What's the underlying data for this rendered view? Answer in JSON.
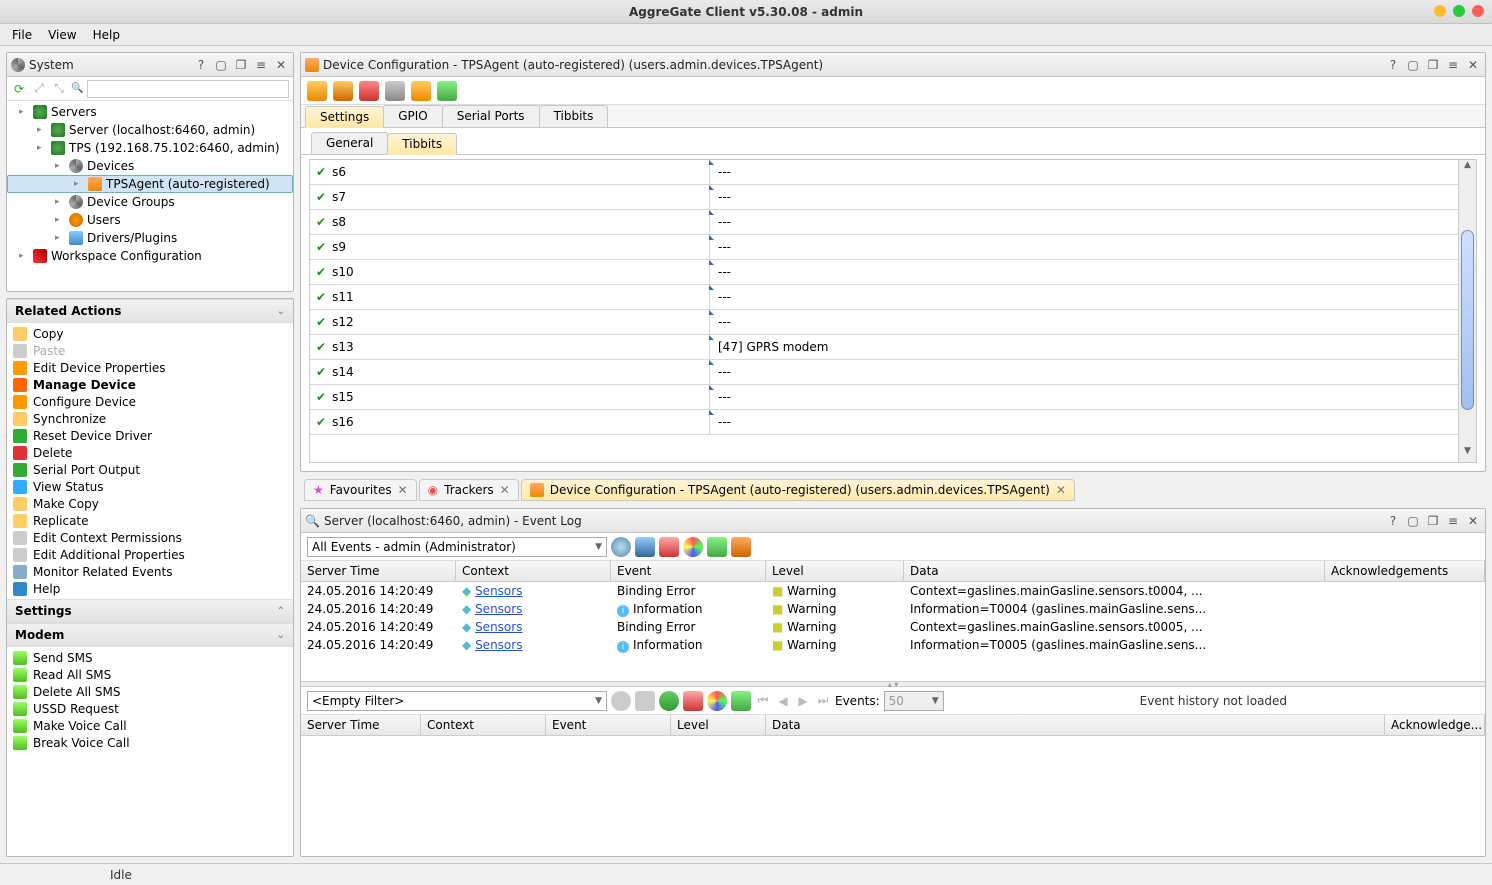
{
  "window": {
    "title": "AggreGate Client v5.30.08 - admin"
  },
  "menu": [
    "File",
    "View",
    "Help"
  ],
  "status": {
    "text": "Idle"
  },
  "system_panel": {
    "title": "System",
    "search_placeholder": "",
    "tree": [
      {
        "label": "Servers",
        "depth": 0
      },
      {
        "label": "Server (localhost:6460, admin)",
        "depth": 1
      },
      {
        "label": "TPS (192.168.75.102:6460, admin)",
        "depth": 1
      },
      {
        "label": "Devices",
        "depth": 2
      },
      {
        "label": "TPSAgent (auto-registered)",
        "depth": 3,
        "selected": true
      },
      {
        "label": "Device Groups",
        "depth": 2
      },
      {
        "label": "Users",
        "depth": 2
      },
      {
        "label": "Drivers/Plugins",
        "depth": 2
      },
      {
        "label": "Workspace Configuration",
        "depth": 0
      }
    ]
  },
  "related_actions": {
    "title": "Related Actions",
    "items": [
      "Copy",
      "Paste",
      "Edit Device Properties",
      "Manage Device",
      "Configure Device",
      "Synchronize",
      "Reset Device Driver",
      "Delete",
      "Serial Port Output",
      "View Status",
      "Make Copy",
      "Replicate",
      "Edit Context Permissions",
      "Edit Additional Properties",
      "Monitor Related Events",
      "Help"
    ]
  },
  "settings_section": {
    "title": "Settings"
  },
  "modem_section": {
    "title": "Modem",
    "items": [
      "Send SMS",
      "Read All SMS",
      "Delete All SMS",
      "USSD Request",
      "Make Voice Call",
      "Break Voice Call"
    ]
  },
  "main_panel": {
    "title": "Device Configuration - TPSAgent (auto-registered) (users.admin.devices.TPSAgent)",
    "tabs_top": [
      "Settings",
      "GPIO",
      "Serial Ports",
      "Tibbits"
    ],
    "tabs_sub": [
      "General",
      "Tibbits"
    ],
    "tibbits": [
      {
        "name": "s6",
        "value": "---"
      },
      {
        "name": "s7",
        "value": "---"
      },
      {
        "name": "s8",
        "value": "---"
      },
      {
        "name": "s9",
        "value": "---"
      },
      {
        "name": "s10",
        "value": "---"
      },
      {
        "name": "s11",
        "value": "---"
      },
      {
        "name": "s12",
        "value": "---"
      },
      {
        "name": "s13",
        "value": "[47] GPRS modem"
      },
      {
        "name": "s14",
        "value": "---"
      },
      {
        "name": "s15",
        "value": "---"
      },
      {
        "name": "s16",
        "value": "---"
      }
    ]
  },
  "doc_tabs": [
    {
      "label": "Favourites"
    },
    {
      "label": "Trackers"
    },
    {
      "label": "Device Configuration - TPSAgent (auto-registered) (users.admin.devices.TPSAgent)",
      "active": true
    }
  ],
  "event_log": {
    "title": "Server (localhost:6460, admin) - Event Log",
    "filter": "All Events - admin (Administrator)",
    "columns": [
      "Server Time",
      "Context",
      "Event",
      "Level",
      "Data",
      "Acknowledgements"
    ],
    "rows": [
      {
        "time": "24.05.2016 14:20:49",
        "context": "Sensors",
        "event": "Binding Error",
        "level": "Warning",
        "data": "Context=gaslines.mainGasline.sensors.t0004, ..."
      },
      {
        "time": "24.05.2016 14:20:49",
        "context": "Sensors",
        "event": "Information",
        "level": "Warning",
        "data": "Information=T0004 (gaslines.mainGasline.sens...",
        "info": true
      },
      {
        "time": "24.05.2016 14:20:49",
        "context": "Sensors",
        "event": "Binding Error",
        "level": "Warning",
        "data": "Context=gaslines.mainGasline.sensors.t0005, ..."
      },
      {
        "time": "24.05.2016 14:20:49",
        "context": "Sensors",
        "event": "Information",
        "level": "Warning",
        "data": "Information=T0005 (gaslines.mainGasline.sens...",
        "info": true
      }
    ],
    "history": {
      "filter": "<Empty Filter>",
      "events_label": "Events:",
      "events_count": "50",
      "message": "Event history not loaded",
      "columns": [
        "Server Time",
        "Context",
        "Event",
        "Level",
        "Data",
        "Acknowledge..."
      ]
    }
  }
}
